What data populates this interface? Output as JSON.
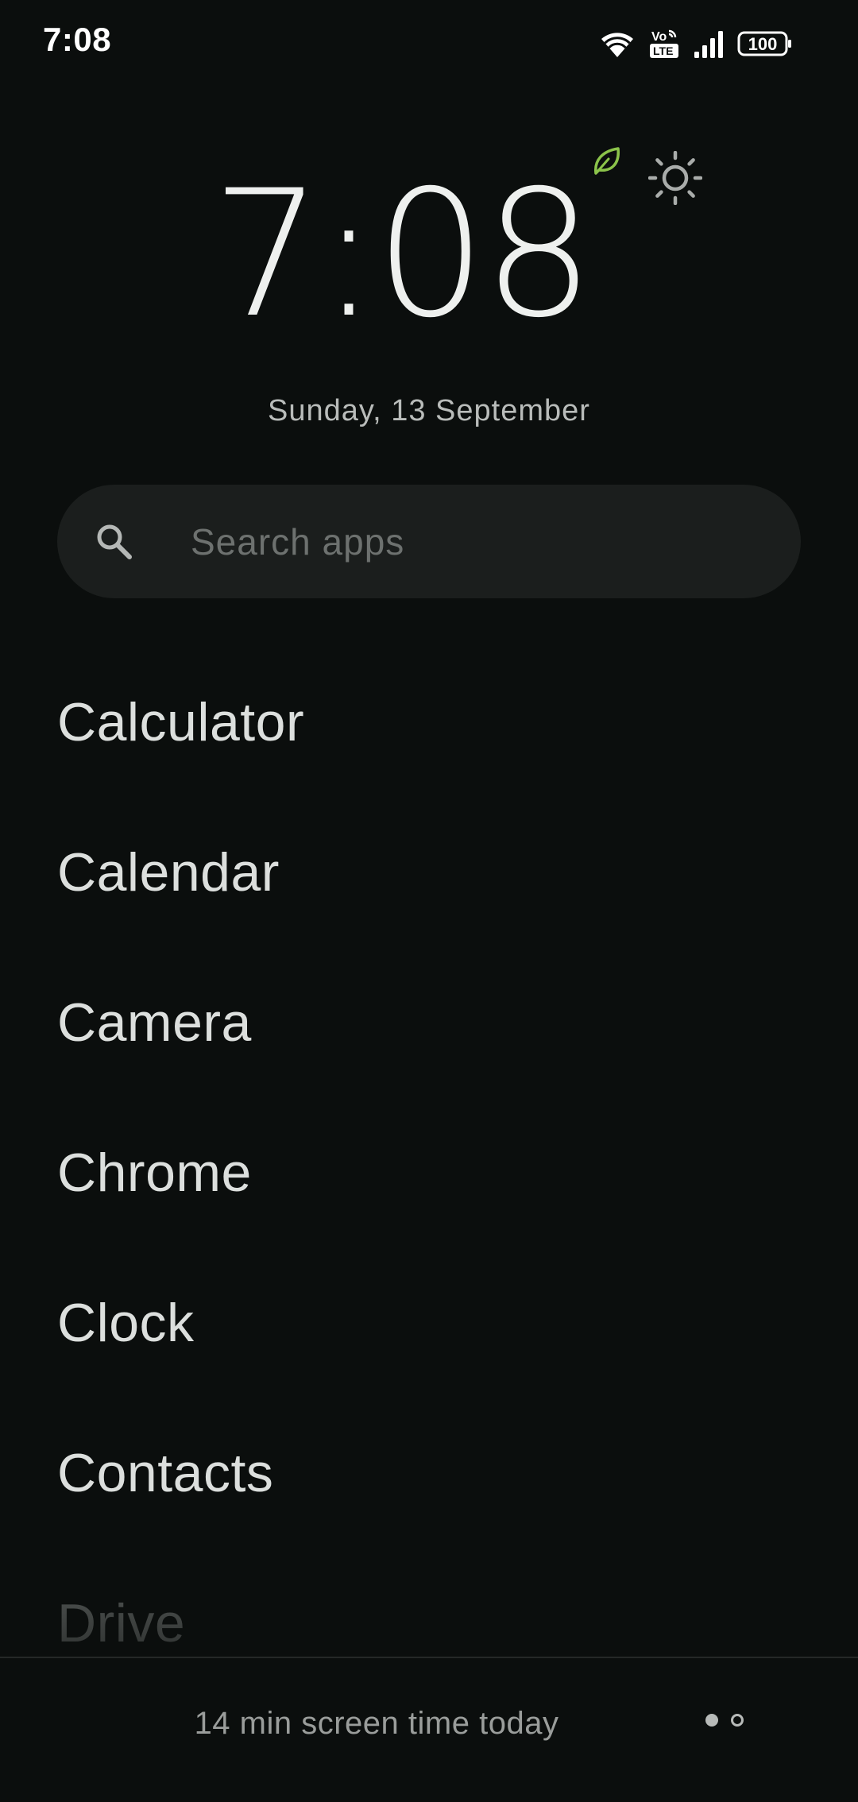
{
  "status_bar": {
    "time": "7:08",
    "battery_level": "100",
    "network_badge_top": "Vo",
    "network_badge_bottom": "LTE"
  },
  "clock": {
    "time": "7:08",
    "date": "Sunday, 13 September",
    "accent_color": "#8bc34a"
  },
  "search": {
    "placeholder": "Search apps"
  },
  "apps": [
    {
      "label": "Calculator"
    },
    {
      "label": "Calendar"
    },
    {
      "label": "Camera"
    },
    {
      "label": "Chrome"
    },
    {
      "label": "Clock"
    },
    {
      "label": "Contacts"
    },
    {
      "label": "Drive"
    }
  ],
  "footer": {
    "screen_time": "14 min screen time today",
    "pages_total": 2,
    "current_page": 1
  },
  "icons": {
    "wifi": "wifi-icon",
    "volte": "volte-lte-icon",
    "signal": "signal-icon",
    "battery": "battery-icon",
    "leaf": "leaf-icon",
    "sun": "sun-icon",
    "search": "search-icon"
  }
}
